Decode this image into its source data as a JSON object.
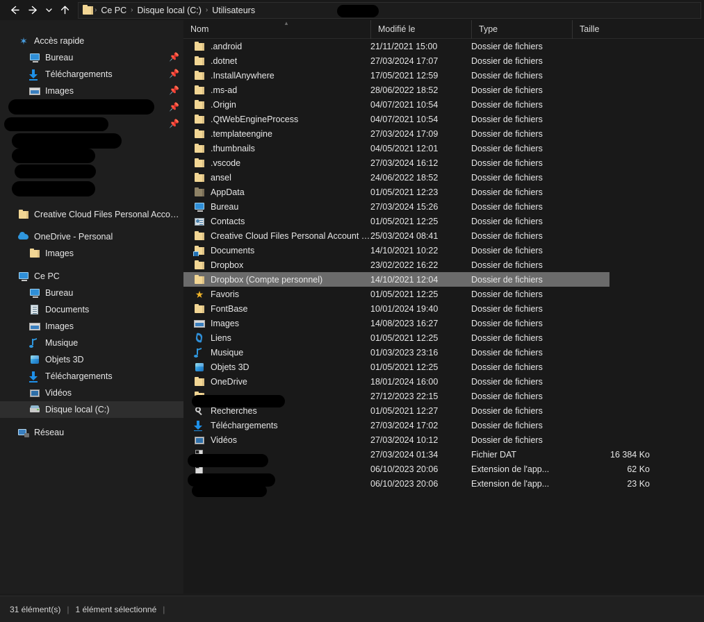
{
  "window": {
    "title": "Explorateur de fichiers",
    "theme_bg": "#191919",
    "sidebar_bg": "#1e1e1e",
    "selection_color": "#6b6b6b",
    "accent_folder": "#f2d694"
  },
  "nav": {
    "back_label": "Précédent",
    "forward_label": "Suivant",
    "recent_label": "Emplacements récents",
    "up_label": "Remonter d'un niveau",
    "breadcrumb": [
      "Ce PC",
      "Disque local (C:)",
      "Utilisateurs"
    ],
    "breadcrumb_redacted": true,
    "separator": "›"
  },
  "sidebar": {
    "items": [
      {
        "label": "Accès rapide",
        "icon": "star-icon",
        "indent": 0,
        "pinned": false,
        "redacted": false,
        "selected": false
      },
      {
        "label": "Bureau",
        "icon": "desktop-icon",
        "indent": 1,
        "pinned": true,
        "redacted": false,
        "selected": false
      },
      {
        "label": "Téléchargements",
        "icon": "download-icon",
        "indent": 1,
        "pinned": true,
        "redacted": false,
        "selected": false
      },
      {
        "label": "Images",
        "icon": "pictures-icon",
        "indent": 1,
        "pinned": true,
        "redacted": false,
        "selected": false
      },
      {
        "label": "",
        "icon": "folder-icon",
        "indent": 1,
        "pinned": true,
        "redacted": true,
        "selected": false
      },
      {
        "label": "",
        "icon": "folder-icon",
        "indent": 1,
        "pinned": true,
        "redacted": true,
        "selected": false
      },
      {
        "label": "",
        "icon": "folder-icon",
        "indent": 1,
        "pinned": false,
        "redacted": true,
        "selected": false
      },
      {
        "label": "",
        "icon": "folder-icon",
        "indent": 1,
        "pinned": false,
        "redacted": true,
        "selected": false
      },
      {
        "label": "",
        "icon": "folder-icon",
        "indent": 1,
        "pinned": false,
        "redacted": true,
        "selected": false
      },
      {
        "label": "",
        "icon": "folder-icon",
        "indent": 1,
        "pinned": false,
        "redacted": true,
        "selected": false
      },
      {
        "label": "Creative Cloud Files Personal Account co",
        "icon": "folder-icon",
        "indent": 0,
        "pinned": false,
        "redacted": false,
        "selected": false
      },
      {
        "label": "OneDrive - Personal",
        "icon": "cloud-icon",
        "indent": 0,
        "pinned": false,
        "redacted": false,
        "selected": false
      },
      {
        "label": "Images",
        "icon": "folder-icon",
        "indent": 1,
        "pinned": false,
        "redacted": false,
        "selected": false
      },
      {
        "label": "Ce PC",
        "icon": "thispc-icon",
        "indent": 0,
        "pinned": false,
        "redacted": false,
        "selected": false
      },
      {
        "label": "Bureau",
        "icon": "desktop-icon",
        "indent": 1,
        "pinned": false,
        "redacted": false,
        "selected": false
      },
      {
        "label": "Documents",
        "icon": "documents-icon",
        "indent": 1,
        "pinned": false,
        "redacted": false,
        "selected": false
      },
      {
        "label": "Images",
        "icon": "pictures-icon",
        "indent": 1,
        "pinned": false,
        "redacted": false,
        "selected": false
      },
      {
        "label": "Musique",
        "icon": "music-icon",
        "indent": 1,
        "pinned": false,
        "redacted": false,
        "selected": false
      },
      {
        "label": "Objets 3D",
        "icon": "objects3d-icon",
        "indent": 1,
        "pinned": false,
        "redacted": false,
        "selected": false
      },
      {
        "label": "Téléchargements",
        "icon": "download-icon",
        "indent": 1,
        "pinned": false,
        "redacted": false,
        "selected": false
      },
      {
        "label": "Vidéos",
        "icon": "videos-icon",
        "indent": 1,
        "pinned": false,
        "redacted": false,
        "selected": false
      },
      {
        "label": "Disque local (C:)",
        "icon": "drive-icon",
        "indent": 1,
        "pinned": false,
        "redacted": false,
        "selected": true
      },
      {
        "label": "Réseau",
        "icon": "network-icon",
        "indent": 0,
        "pinned": false,
        "redacted": false,
        "selected": false
      }
    ]
  },
  "filelist": {
    "columns": [
      {
        "key": "name",
        "label": "Nom",
        "sorted": "asc"
      },
      {
        "key": "date",
        "label": "Modifié le",
        "sorted": ""
      },
      {
        "key": "type",
        "label": "Type",
        "sorted": ""
      },
      {
        "key": "size",
        "label": "Taille",
        "sorted": ""
      }
    ],
    "folder_type_label": "Dossier de fichiers",
    "rows": [
      {
        "name": ".android",
        "date": "21/11/2021 15:00",
        "type": "Dossier de fichiers",
        "size": "",
        "icon": "folder-icon",
        "redacted": false,
        "selected": false
      },
      {
        "name": ".dotnet",
        "date": "27/03/2024 17:07",
        "type": "Dossier de fichiers",
        "size": "",
        "icon": "folder-icon",
        "redacted": false,
        "selected": false
      },
      {
        "name": ".InstallAnywhere",
        "date": "17/05/2021 12:59",
        "type": "Dossier de fichiers",
        "size": "",
        "icon": "folder-icon",
        "redacted": false,
        "selected": false
      },
      {
        "name": ".ms-ad",
        "date": "28/06/2022 18:52",
        "type": "Dossier de fichiers",
        "size": "",
        "icon": "folder-icon",
        "redacted": false,
        "selected": false
      },
      {
        "name": ".Origin",
        "date": "04/07/2021 10:54",
        "type": "Dossier de fichiers",
        "size": "",
        "icon": "folder-icon",
        "redacted": false,
        "selected": false
      },
      {
        "name": ".QtWebEngineProcess",
        "date": "04/07/2021 10:54",
        "type": "Dossier de fichiers",
        "size": "",
        "icon": "folder-icon",
        "redacted": false,
        "selected": false
      },
      {
        "name": ".templateengine",
        "date": "27/03/2024 17:09",
        "type": "Dossier de fichiers",
        "size": "",
        "icon": "folder-icon",
        "redacted": false,
        "selected": false
      },
      {
        "name": ".thumbnails",
        "date": "04/05/2021 12:01",
        "type": "Dossier de fichiers",
        "size": "",
        "icon": "folder-icon",
        "redacted": false,
        "selected": false
      },
      {
        "name": ".vscode",
        "date": "27/03/2024 16:12",
        "type": "Dossier de fichiers",
        "size": "",
        "icon": "folder-icon",
        "redacted": false,
        "selected": false
      },
      {
        "name": "ansel",
        "date": "24/06/2022 18:52",
        "type": "Dossier de fichiers",
        "size": "",
        "icon": "folder-icon",
        "redacted": false,
        "selected": false
      },
      {
        "name": "AppData",
        "date": "01/05/2021 12:23",
        "type": "Dossier de fichiers",
        "size": "",
        "icon": "folder-hidden-icon",
        "redacted": false,
        "selected": false
      },
      {
        "name": "Bureau",
        "date": "27/03/2024 15:26",
        "type": "Dossier de fichiers",
        "size": "",
        "icon": "desktop-icon",
        "redacted": false,
        "selected": false
      },
      {
        "name": "Contacts",
        "date": "01/05/2021 12:25",
        "type": "Dossier de fichiers",
        "size": "",
        "icon": "contacts-icon",
        "redacted": false,
        "selected": false
      },
      {
        "name": "Creative Cloud Files Personal Account co...",
        "date": "25/03/2024 08:41",
        "type": "Dossier de fichiers",
        "size": "",
        "icon": "folder-icon",
        "redacted": false,
        "selected": false
      },
      {
        "name": "Documents",
        "date": "14/10/2021 10:22",
        "type": "Dossier de fichiers",
        "size": "",
        "icon": "folder-shortcut-icon",
        "redacted": false,
        "selected": false
      },
      {
        "name": "Dropbox",
        "date": "23/02/2022 16:22",
        "type": "Dossier de fichiers",
        "size": "",
        "icon": "folder-icon",
        "redacted": false,
        "selected": false
      },
      {
        "name": "Dropbox (Compte personnel)",
        "date": "14/10/2021 12:04",
        "type": "Dossier de fichiers",
        "size": "",
        "icon": "folder-icon",
        "redacted": false,
        "selected": true
      },
      {
        "name": "Favoris",
        "date": "01/05/2021 12:25",
        "type": "Dossier de fichiers",
        "size": "",
        "icon": "favorites-star-icon",
        "redacted": false,
        "selected": false
      },
      {
        "name": "FontBase",
        "date": "10/01/2024 19:40",
        "type": "Dossier de fichiers",
        "size": "",
        "icon": "folder-icon",
        "redacted": false,
        "selected": false
      },
      {
        "name": "Images",
        "date": "14/08/2023 16:27",
        "type": "Dossier de fichiers",
        "size": "",
        "icon": "pictures-icon",
        "redacted": false,
        "selected": false
      },
      {
        "name": "Liens",
        "date": "01/05/2021 12:25",
        "type": "Dossier de fichiers",
        "size": "",
        "icon": "links-icon",
        "redacted": false,
        "selected": false
      },
      {
        "name": "Musique",
        "date": "01/03/2023 23:16",
        "type": "Dossier de fichiers",
        "size": "",
        "icon": "music-icon",
        "redacted": false,
        "selected": false
      },
      {
        "name": "Objets 3D",
        "date": "01/05/2021 12:25",
        "type": "Dossier de fichiers",
        "size": "",
        "icon": "objects3d-icon",
        "redacted": false,
        "selected": false
      },
      {
        "name": "OneDrive",
        "date": "18/01/2024 16:00",
        "type": "Dossier de fichiers",
        "size": "",
        "icon": "folder-icon",
        "redacted": false,
        "selected": false
      },
      {
        "name": "",
        "date": "27/12/2023 22:15",
        "type": "Dossier de fichiers",
        "size": "",
        "icon": "folder-icon",
        "redacted": true,
        "selected": false
      },
      {
        "name": "Recherches",
        "date": "01/05/2021 12:27",
        "type": "Dossier de fichiers",
        "size": "",
        "icon": "search-folder-icon",
        "redacted": false,
        "selected": false
      },
      {
        "name": "Téléchargements",
        "date": "27/03/2024 17:02",
        "type": "Dossier de fichiers",
        "size": "",
        "icon": "download-icon",
        "redacted": false,
        "selected": false
      },
      {
        "name": "Vidéos",
        "date": "27/03/2024 10:12",
        "type": "Dossier de fichiers",
        "size": "",
        "icon": "videos-icon",
        "redacted": false,
        "selected": false
      },
      {
        "name": "",
        "date": "27/03/2024 01:34",
        "type": "Fichier DAT",
        "size": "16 384 Ko",
        "icon": "dat-file-icon",
        "redacted": true,
        "selected": false
      },
      {
        "name": "",
        "date": "06/10/2023 20:06",
        "type": "Extension de l'app...",
        "size": "62 Ko",
        "icon": "dll-file-icon",
        "redacted": true,
        "selected": false
      },
      {
        "name": "",
        "date": "06/10/2023 20:06",
        "type": "Extension de l'app...",
        "size": "23 Ko",
        "icon": "dll-file-icon",
        "redacted": true,
        "selected": false
      }
    ]
  },
  "statusbar": {
    "item_count": "31 élément(s)",
    "selection_count": "1 élément sélectionné",
    "separator": "|"
  }
}
